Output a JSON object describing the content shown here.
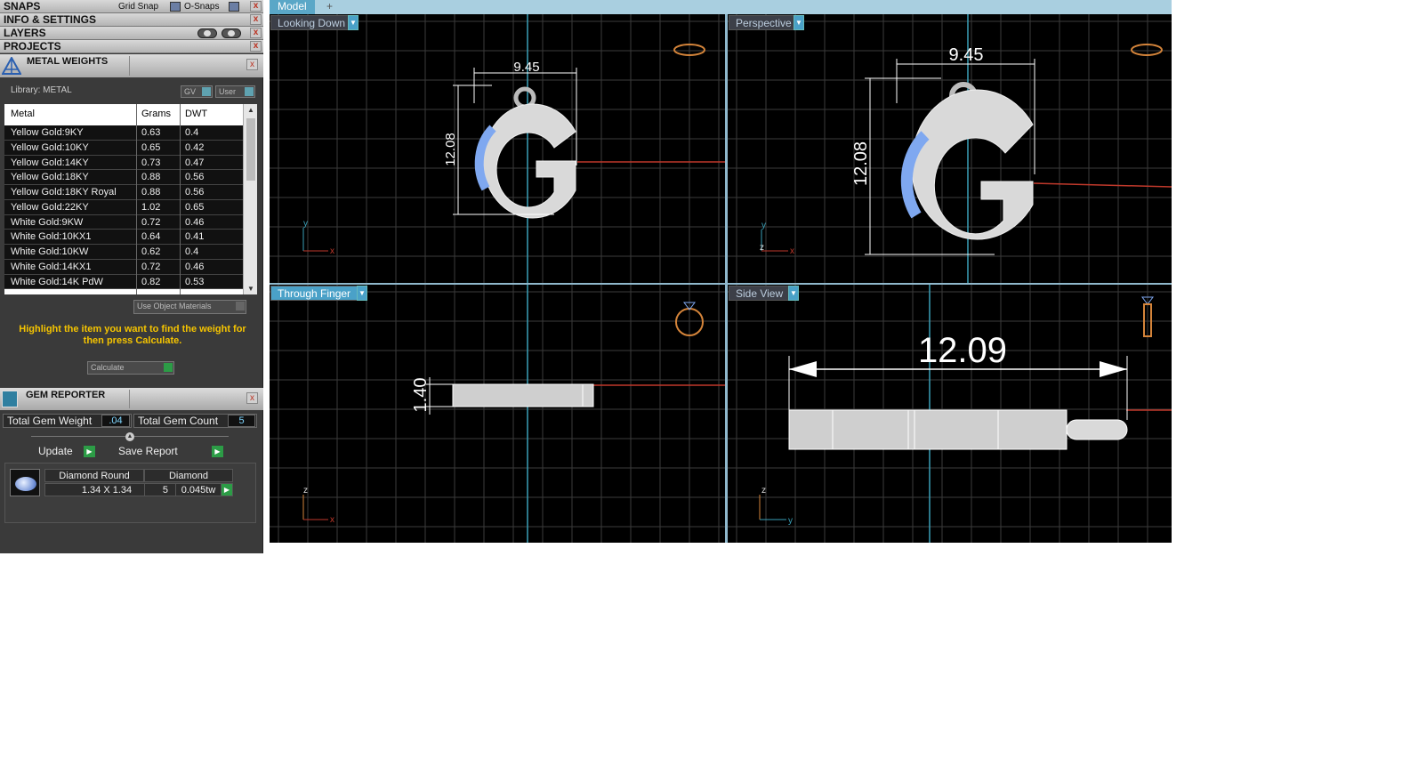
{
  "panel": {
    "snaps": {
      "title": "SNAPS",
      "grid_snap": "Grid Snap",
      "o_snaps": "O-Snaps"
    },
    "info_settings": "INFO & SETTINGS",
    "layers": "LAYERS",
    "projects": "PROJECTS",
    "close_glyph": "x"
  },
  "metal_weights": {
    "title": "METAL WEIGHTS",
    "library": "Library: METAL",
    "gv": "GV",
    "user": "User",
    "columns": [
      "Metal",
      "Grams",
      "DWT"
    ],
    "rows": [
      [
        "Yellow Gold:9KY",
        "0.63",
        "0.4"
      ],
      [
        "Yellow Gold:10KY",
        "0.65",
        "0.42"
      ],
      [
        "Yellow Gold:14KY",
        "0.73",
        "0.47"
      ],
      [
        "Yellow Gold:18KY",
        "0.88",
        "0.56"
      ],
      [
        "Yellow Gold:18KY Royal",
        "0.88",
        "0.56"
      ],
      [
        "Yellow Gold:22KY",
        "1.02",
        "0.65"
      ],
      [
        "White Gold:9KW",
        "0.72",
        "0.46"
      ],
      [
        "White Gold:10KX1",
        "0.64",
        "0.41"
      ],
      [
        "White Gold:10KW",
        "0.62",
        "0.4"
      ],
      [
        "White Gold:14KX1",
        "0.72",
        "0.46"
      ],
      [
        "White Gold:14K PdW",
        "0.82",
        "0.53"
      ]
    ],
    "use_object_materials": "Use Object Materials",
    "hint": "Highlight the item you want to find the weight for then press Calculate.",
    "calculate": "Calculate"
  },
  "gem_reporter": {
    "title": "GEM REPORTER",
    "total_gem_weight_label": "Total Gem Weight",
    "total_gem_weight": ".04",
    "total_gem_count_label": "Total Gem Count",
    "total_gem_count": "5",
    "update": "Update",
    "save_report": "Save Report",
    "gem": {
      "shape": "Diamond Round",
      "material": "Diamond",
      "size": "1.34 X 1.34",
      "count": "5",
      "weight": "0.045tw"
    }
  },
  "tabs": {
    "model": "Model",
    "add": "+"
  },
  "views": {
    "looking_down": {
      "label": "Looking Down",
      "width_dim": "9.45",
      "height_dim": "12.08"
    },
    "perspective": {
      "label": "Perspective",
      "width_dim": "9.45",
      "height_dim": "12.08"
    },
    "through_finger": {
      "label": "Through Finger",
      "thickness_dim": "1.40"
    },
    "side_view": {
      "label": "Side View",
      "length_dim": "12.09"
    }
  },
  "axes": {
    "x": "x",
    "y": "y",
    "z": "z"
  },
  "colors": {
    "accent": "#4aa1c8",
    "hint": "#f5c400",
    "gem": "#7fa8f0",
    "axis_x": "#c0392b",
    "axis_y": "#3aa0b8"
  }
}
